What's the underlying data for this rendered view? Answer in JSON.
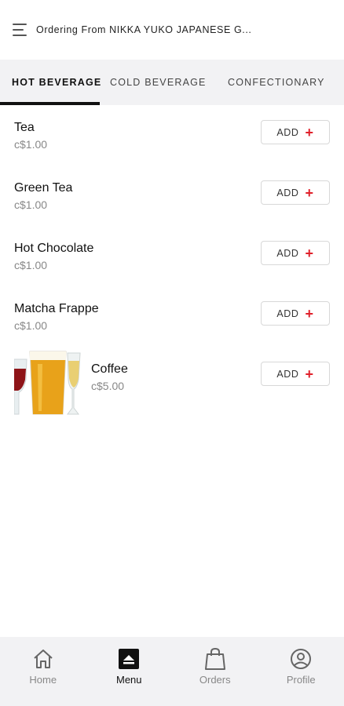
{
  "header": {
    "title": "Ordering From NIKKA YUKO JAPANESE G..."
  },
  "tabs": [
    {
      "label": "HOT BEVERAGE",
      "active": true
    },
    {
      "label": "COLD BEVERAGE",
      "active": false
    },
    {
      "label": "CONFECTIONARY",
      "active": false
    }
  ],
  "items": [
    {
      "name": "Tea",
      "price": "c$1.00",
      "add_label": "ADD"
    },
    {
      "name": "Green Tea",
      "price": "c$1.00",
      "add_label": "ADD"
    },
    {
      "name": "Hot Chocolate",
      "price": "c$1.00",
      "add_label": "ADD"
    },
    {
      "name": "Matcha Frappe",
      "price": "c$1.00",
      "add_label": "ADD"
    },
    {
      "name": "Coffee",
      "price": "c$5.00",
      "add_label": "ADD",
      "image": "drinks-photo"
    }
  ],
  "bottom_nav": [
    {
      "label": "Home",
      "icon": "home-icon"
    },
    {
      "label": "Menu",
      "icon": "menu-icon",
      "active": true
    },
    {
      "label": "Orders",
      "icon": "bag-icon"
    },
    {
      "label": "Profile",
      "icon": "profile-icon"
    }
  ],
  "colors": {
    "accent": "#e0212b",
    "tab_bar_bg": "#f2f2f4",
    "text_primary": "#111111",
    "text_muted": "#888888"
  }
}
